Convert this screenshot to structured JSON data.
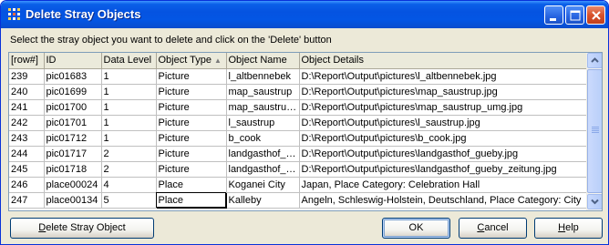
{
  "window": {
    "title": "Delete Stray Objects",
    "icon": "app-icon"
  },
  "instruction": "Select the stray object you want to delete and click on the 'Delete' button",
  "table": {
    "columns": [
      "[row#]",
      "ID",
      "Data Level",
      "Object Type",
      "Object Name",
      "Object Details"
    ],
    "sorted_column": "Object Type",
    "rows": [
      [
        "239",
        "pic01683",
        "1",
        "Picture",
        "l_altbennebek",
        "D:\\Report\\Output\\pictures\\l_altbennebek.jpg"
      ],
      [
        "240",
        "pic01699",
        "1",
        "Picture",
        "map_saustrup",
        "D:\\Report\\Output\\pictures\\map_saustrup.jpg"
      ],
      [
        "241",
        "pic01700",
        "1",
        "Picture",
        "map_saustrup_umg",
        "D:\\Report\\Output\\pictures\\map_saustrup_umg.jpg"
      ],
      [
        "242",
        "pic01701",
        "1",
        "Picture",
        "l_saustrup",
        "D:\\Report\\Output\\pictures\\l_saustrup.jpg"
      ],
      [
        "243",
        "pic01712",
        "1",
        "Picture",
        "b_cook",
        "D:\\Report\\Output\\pictures\\b_cook.jpg"
      ],
      [
        "244",
        "pic01717",
        "2",
        "Picture",
        "landgasthof_gueby",
        "D:\\Report\\Output\\pictures\\landgasthof_gueby.jpg"
      ],
      [
        "245",
        "pic01718",
        "2",
        "Picture",
        "landgasthof_gueby_zeitung",
        "D:\\Report\\Output\\pictures\\landgasthof_gueby_zeitung.jpg"
      ],
      [
        "246",
        "place00024",
        "4",
        "Place",
        "Koganei City",
        "Japan, Place Category: Celebration Hall"
      ],
      [
        "247",
        "place00134",
        "5",
        "Place",
        "Kalleby",
        "Angeln, Schleswig-Holstein, Deutschland, Place Category: City"
      ]
    ],
    "selected_row": 8,
    "selected_col": 3
  },
  "buttons": {
    "delete": "Delete Stray Object",
    "ok": "OK",
    "cancel": "Cancel",
    "help": "Help"
  },
  "colors": {
    "titlebar": "#0553e1",
    "dialog_bg": "#ece9d8",
    "border": "#0831d9"
  }
}
